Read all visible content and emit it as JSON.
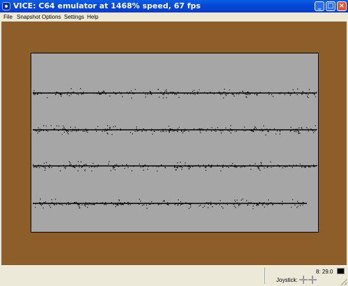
{
  "window": {
    "title": "VICE: C64 emulator at 1468% speed, 67 fps",
    "minimize_glyph": "_",
    "maximize_glyph": "□",
    "close_glyph": "×"
  },
  "menu": {
    "items": [
      "File",
      "Snapshot",
      "Options",
      "Settings",
      "Help"
    ]
  },
  "colors": {
    "border": "#8d5d2a",
    "screen": "#a6a6a6",
    "ink": "#000000"
  },
  "status": {
    "drive_track": "8: 29.0",
    "joystick_label": "Joystick:"
  }
}
